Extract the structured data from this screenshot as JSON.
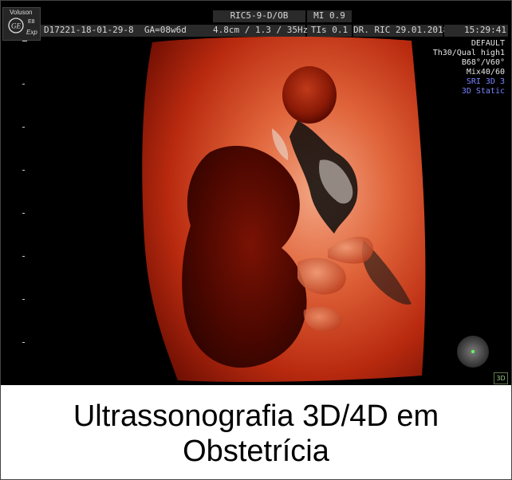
{
  "header": {
    "brand_line1": "Voluson",
    "brand_line2": "E8",
    "brand_line3": "Exp",
    "patient_id": "D17221-18-01-29-8",
    "ga": "GA=08w6d",
    "probe": "RIC5-9-D/OB",
    "mi": "MI  0.9",
    "depth_freq": "4.8cm / 1.3 / 35Hz",
    "tis": "TIs  0.1",
    "doctor_date": "DR. RIC  29.01.2018",
    "time": "15:29:41"
  },
  "settings": {
    "line1": "DEFAULT",
    "line2": "Th30/Qual high1",
    "line3": "B68°/V60°",
    "line4": "Mix40/60",
    "line5": "SRI 3D 3",
    "line6": "3D Static"
  },
  "mode_badge": "3D",
  "caption": {
    "line1": "Ultrassonografia 3D/4D em",
    "line2": "Obstetrícia"
  },
  "colors": {
    "tissue_dark": "#3a0500",
    "tissue_mid": "#b32a10",
    "tissue_light": "#e8845a",
    "highlight": "#f6c3a0",
    "settings_blue": "#7b84ff"
  }
}
